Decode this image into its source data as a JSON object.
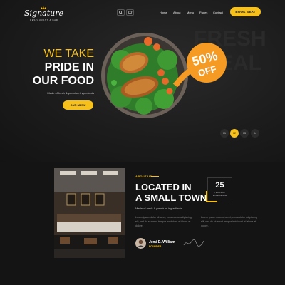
{
  "colors": {
    "accent": "#f7c01a",
    "background": "#141414",
    "badge": "#f59a23"
  },
  "header": {
    "logo_text": "Signature",
    "logo_tagline": "RESTAURANT & BAR",
    "nav": [
      "Home",
      "About",
      "Menu",
      "Pages",
      "Contact"
    ],
    "book_label": "BOOK SEAT",
    "icons": [
      "search-icon",
      "cart-icon"
    ]
  },
  "hero": {
    "line1": "WE TAKE",
    "line2": "PRIDE IN",
    "line3": "OUR FOOD",
    "subtitle": "Made of fresh & premium ingredients",
    "button_label": "OUR MENU",
    "badge_percent": "50%",
    "badge_off": "OFF",
    "background_words": [
      "FRESH",
      "MEAL"
    ],
    "slides": [
      "01",
      "02",
      "03",
      "04"
    ],
    "active_slide_index": 1
  },
  "about": {
    "eyebrow": "ABOUT US",
    "title_line1": "LOCATED IN",
    "title_line2": "A SMALL TOWN",
    "subtitle": "Made of fresh & premium ingredients",
    "para1": "Lorem ipsum dolor sit amet, consectetur adipiscing elit, sed do eiusmod tempor incididunt ut labore et dolore.",
    "para2": "Lorem ipsum dolor sit amet, consectetur adipiscing elit, sed do eiusmod tempor incididunt ut labore et dolore.",
    "years_value": "25",
    "years_label_line1": "YEARS OF",
    "years_label_line2": "EXPERIENCE",
    "author_name": "Jemi D. William",
    "author_role": "FOUNDER"
  }
}
